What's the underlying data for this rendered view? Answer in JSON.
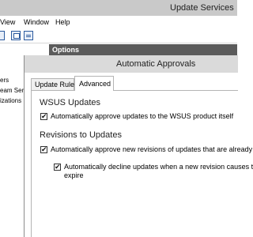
{
  "window": {
    "title": "Update Services"
  },
  "menubar": {
    "items": [
      "View",
      "Window",
      "Help"
    ]
  },
  "tree": {
    "nodes": [
      "ers",
      "eam Serv",
      "izations"
    ]
  },
  "options_header": {
    "label": "Options"
  },
  "dialog": {
    "title": "Automatic Approvals",
    "tabs": [
      {
        "label": "Update Rules",
        "selected": false
      },
      {
        "label": "Advanced",
        "selected": true
      }
    ],
    "sections": {
      "wsus": {
        "heading": "WSUS Updates",
        "option_label": "Automatically approve updates to the WSUS product itself",
        "checked": true
      },
      "revisions": {
        "heading": "Revisions to Updates",
        "option_label": "Automatically approve new revisions of updates that are already",
        "checked": true,
        "sub_option_line1": "Automatically decline updates when a new revision causes t",
        "sub_option_line2": "expire",
        "sub_checked": true
      }
    },
    "check_glyph": "✔"
  },
  "colors": {
    "titlebar": "#c9c9c9",
    "dialog_titlebar": "#dadada",
    "options_header": "#5b5b5b",
    "toolbar_icon": "#2b5a9e"
  }
}
